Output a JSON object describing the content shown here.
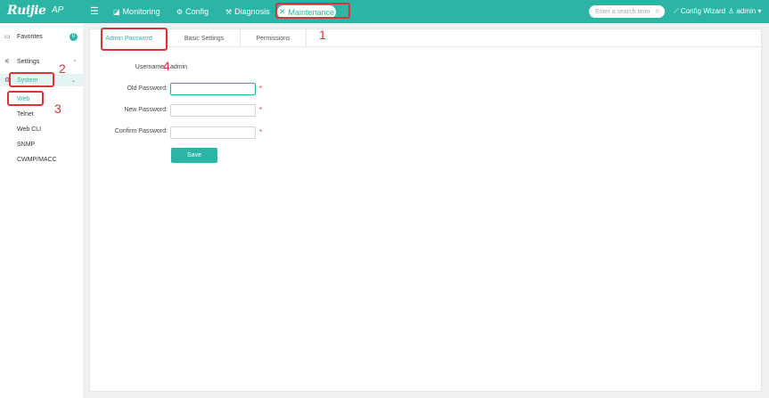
{
  "header": {
    "logo": "Ruijie",
    "logo_suffix": "AP",
    "nav": [
      {
        "label": "Monitoring",
        "icon": "monitor-icon"
      },
      {
        "label": "Config",
        "icon": "gear-icon"
      },
      {
        "label": "Diagnosis",
        "icon": "wrench-icon"
      },
      {
        "label": "Maintenance",
        "icon": "tools-icon",
        "active": true
      }
    ],
    "search_placeholder": "Enter a search term",
    "config_wizard": "Config Wizard",
    "user": "admin"
  },
  "sidebar": {
    "favorites": "Favorites",
    "favorites_count": "0",
    "settings": "Settings",
    "system": "System",
    "system_children": [
      "Web",
      "Telnet",
      "Web CLI",
      "SNMP",
      "CWMP/MACC"
    ]
  },
  "tabs": [
    "Admin Password",
    "Basic Settings",
    "Permissions"
  ],
  "form": {
    "username_label": "Username:",
    "username_value": "admin",
    "old_password_label": "Old Password:",
    "new_password_label": "New Password:",
    "confirm_password_label": "Confirm Password:",
    "required_mark": "*",
    "save": "Save"
  },
  "annotations": [
    "1",
    "2",
    "3",
    "4"
  ],
  "colors": {
    "accent": "#2cb5a5",
    "annotation": "#d9343a",
    "required": "#e24a3b"
  }
}
